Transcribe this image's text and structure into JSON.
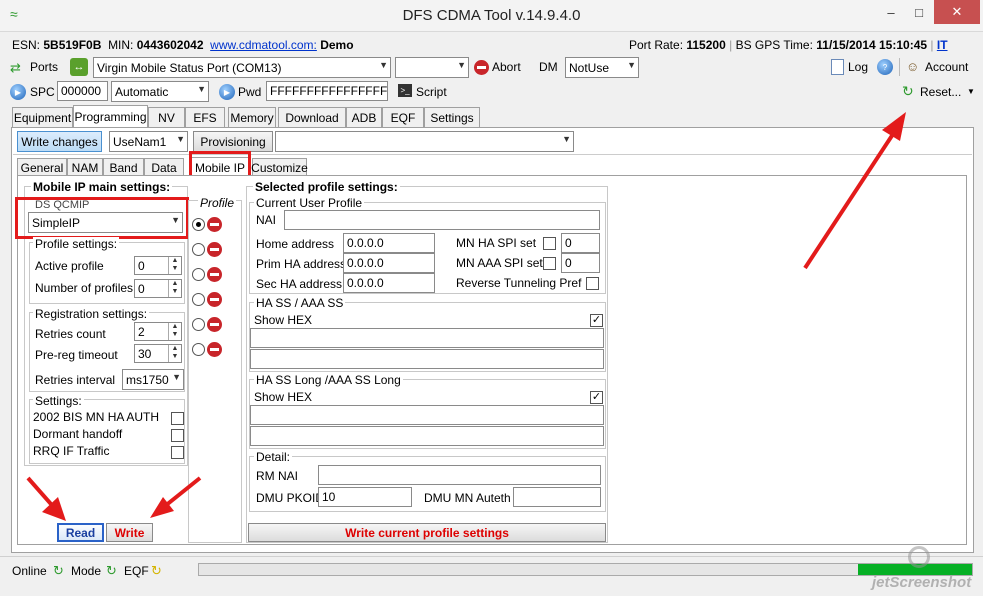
{
  "window": {
    "title": "DFS CDMA Tool v.14.9.4.0"
  },
  "info": {
    "esn_label": "ESN:",
    "esn": "5B519F0B",
    "min_label": "MIN:",
    "min": "0443602042",
    "site": "www.cdmatool.com:",
    "mode": "Demo",
    "port_rate_label": "Port Rate:",
    "port_rate": "115200",
    "gps_label": "BS GPS Time:",
    "gps_time": "11/15/2014 15:10:45",
    "it": "IT"
  },
  "toolbar1": {
    "ports": "Ports",
    "port": "Virgin Mobile Status Port (COM13)",
    "abort": "Abort",
    "dm_label": "DM",
    "dm_value": "NotUse",
    "log": "Log",
    "account": "Account"
  },
  "toolbar2": {
    "spc_label": "SPC",
    "spc_value": "000000",
    "spc_mode": "Automatic",
    "pwd_label": "Pwd",
    "pwd_value": "FFFFFFFFFFFFFFFF",
    "script": "Script",
    "reset": "Reset..."
  },
  "main_tabs": [
    "Equipment",
    "Programming",
    "NV",
    "EFS",
    "Memory",
    "Download",
    "ADB",
    "EQF",
    "Settings"
  ],
  "prog": {
    "write_changes": "Write changes",
    "nam": "UseNam1",
    "provisioning": "Provisioning"
  },
  "sub_tabs": [
    "General",
    "NAM",
    "Band",
    "Data",
    "Mobile IP",
    "Customize"
  ],
  "mip": {
    "main_title": "Mobile IP main settings:",
    "ds_qcmip": "DS QCMIP",
    "qcmip_value": "SimpleIP",
    "profile_col": "Profile",
    "profile_settings": "Profile settings:",
    "active_profile": "Active profile",
    "active_profile_value": "0",
    "num_profiles": "Number of profiles",
    "num_profiles_value": "0",
    "reg_settings": "Registration settings:",
    "retries_count": "Retries count",
    "retries_count_value": "2",
    "prereg_timeout": "Pre-reg timeout",
    "prereg_timeout_value": "30",
    "retries_interval": "Retries interval",
    "retries_interval_value": "ms1750",
    "settings": "Settings:",
    "opt1": "2002 BIS MN HA AUTH",
    "opt2": "Dormant handoff",
    "opt3": "RRQ IF Traffic",
    "read": "Read",
    "write": "Write"
  },
  "sel": {
    "title": "Selected profile settings:",
    "cur_user": "Current User Profile",
    "nai": "NAI",
    "home_addr": "Home address",
    "home_addr_value": "0.0.0.0",
    "prim_ha": "Prim HA address",
    "prim_ha_value": "0.0.0.0",
    "sec_ha": "Sec HA address",
    "sec_ha_value": "0.0.0.0",
    "mn_ha_spi": "MN HA SPI set",
    "mn_ha_spi_value": "0",
    "mn_aaa_spi": "MN AAA SPI set",
    "mn_aaa_spi_value": "0",
    "rev_tun": "Reverse Tunneling Pref",
    "ha_ss": "HA SS / AAA SS",
    "show_hex": "Show HEX",
    "ha_ss_long": "HA SS Long /AAA SS Long",
    "detail": "Detail:",
    "rm_nai": "RM NAI",
    "dmu_pkoid": "DMU PKOID",
    "dmu_pkoid_value": "10",
    "dmu_mn_auteth": "DMU MN Auteth",
    "write_profile": "Write current profile settings"
  },
  "status": {
    "online": "Online",
    "mode": "Mode",
    "eqf": "EQF"
  },
  "watermark": "jetScreenshot"
}
